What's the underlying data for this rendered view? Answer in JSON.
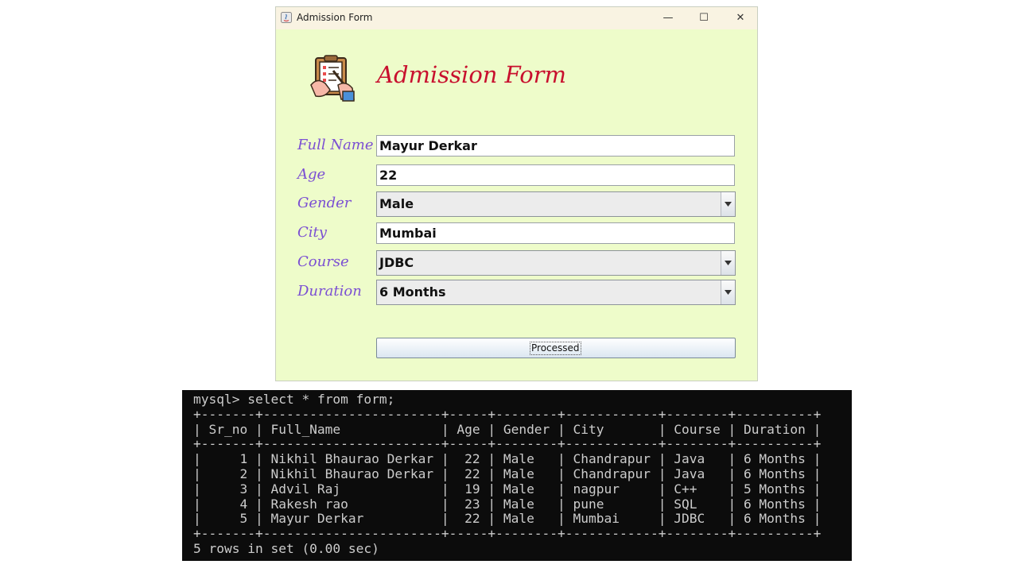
{
  "window": {
    "title": "Admission Form",
    "controls": {
      "minimize": "—",
      "maximize": "☐",
      "close": "✕"
    }
  },
  "form": {
    "heading": "Admission Form",
    "fields": [
      {
        "label": "Full Name",
        "value": "Mayur Derkar",
        "type": "text"
      },
      {
        "label": "Age",
        "value": "22",
        "type": "text"
      },
      {
        "label": "Gender",
        "value": "Male",
        "type": "combo"
      },
      {
        "label": "City",
        "value": "Mumbai",
        "type": "text"
      },
      {
        "label": "Course",
        "value": "JDBC",
        "type": "combo"
      },
      {
        "label": "Duration",
        "value": "6 Months",
        "type": "combo"
      }
    ],
    "submit_label": "Processed"
  },
  "colors": {
    "window_bg": "#eefcca",
    "label": "#7b4fd3",
    "heading": "#c8102e",
    "terminal_bg": "#0c0c0c",
    "terminal_fg": "#cccccc"
  },
  "terminal": {
    "prompt": "mysql>",
    "command": "select * from form;",
    "columns": [
      "Sr_no",
      "Full_Name",
      "Age",
      "Gender",
      "City",
      "Course",
      "Duration"
    ],
    "rows": [
      [
        "1",
        "Nikhil Bhaurao Derkar",
        "22",
        "Male",
        "Chandrapur",
        "Java",
        "6 Months"
      ],
      [
        "2",
        "Nikhil Bhaurao Derkar",
        "22",
        "Male",
        "Chandrapur",
        "Java",
        "6 Months"
      ],
      [
        "3",
        "Advil Raj",
        "19",
        "Male",
        "nagpur",
        "C++",
        "5 Months"
      ],
      [
        "4",
        "Rakesh rao",
        "23",
        "Male",
        "pune",
        "SQL",
        "6 Months"
      ],
      [
        "5",
        "Mayur Derkar",
        "22",
        "Male",
        "Mumbai",
        "JDBC",
        "6 Months"
      ]
    ],
    "summary": "5 rows in set (0.00 sec)"
  }
}
